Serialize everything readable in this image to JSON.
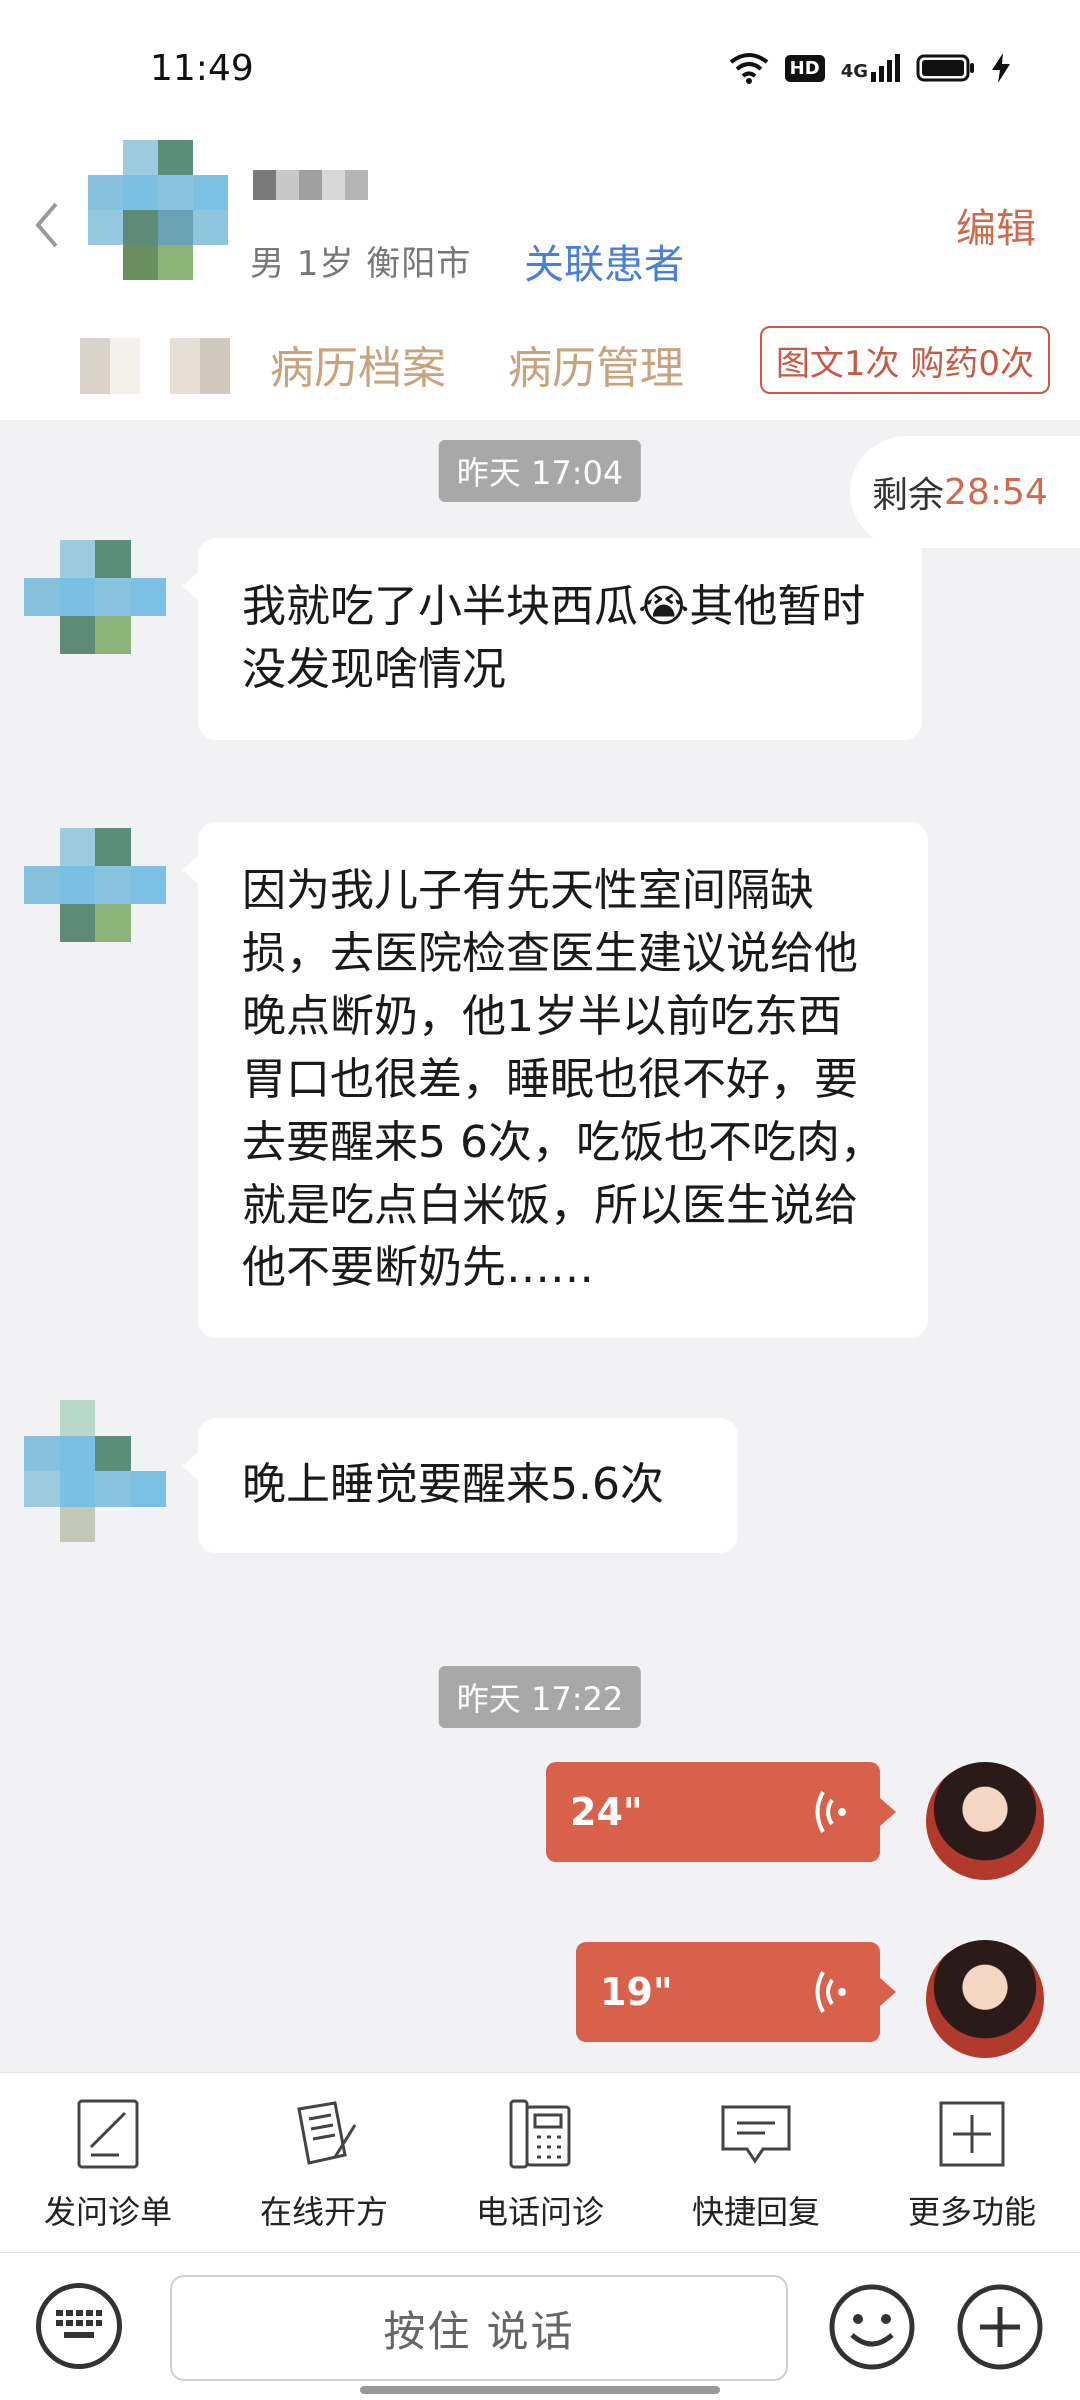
{
  "status_bar": {
    "time": "11:49",
    "hd": "HD",
    "network": "4G"
  },
  "header": {
    "patient_info": "男 1岁  衡阳市",
    "link_patient": "关联患者",
    "edit": "编辑",
    "tabs": [
      "病历档案",
      "病历管理"
    ],
    "consult_count": "图文1次 购药0次"
  },
  "chat": {
    "remaining_label": "剩余",
    "remaining_time": "28:54",
    "time_1": "昨天 17:04",
    "messages": [
      "我就吃了小半块西瓜😭其他暂时没发现啥情况",
      "因为我儿子有先天性室间隔缺损，去医院检查医生建议说给他晚点断奶，他1岁半以前吃东西胃口也很差，睡眠也很不好，要去要醒来5 6次，吃饭也不吃肉，就是吃点白米饭，所以医生说给他不要断奶先……",
      "晚上睡觉要醒来5.6次"
    ],
    "time_2": "昨天 17:22",
    "voices": [
      "24\"",
      "19\""
    ]
  },
  "toolbar": {
    "items": [
      "发问诊单",
      "在线开方",
      "电话问诊",
      "快捷回复",
      "更多功能"
    ]
  },
  "input": {
    "hold_to_talk": "按住 说话"
  },
  "colors": {
    "accent": "#d9604b",
    "link": "#4a7fd4",
    "tab": "#c9a27e"
  }
}
